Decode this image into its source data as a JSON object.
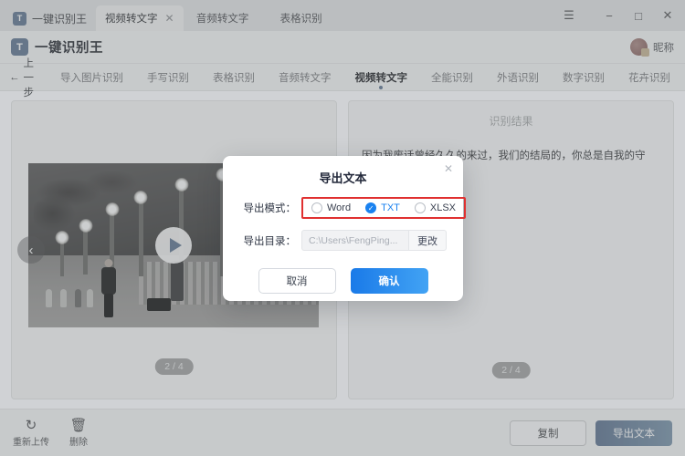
{
  "window": {
    "brand_tab_label": "一键识别王",
    "brand_mark": "T",
    "tabs": [
      {
        "label": "视频转文字",
        "active": true,
        "closable": true
      },
      {
        "label": "音频转文字",
        "active": false,
        "closable": false
      },
      {
        "label": "表格识别",
        "active": false,
        "closable": false
      }
    ],
    "controls": {
      "menu": "☰",
      "minimize": "−",
      "maximize": "□",
      "close": "✕"
    }
  },
  "header": {
    "app_name": "一键识别王",
    "app_mark": "T",
    "user_nickname": "昵称"
  },
  "nav": {
    "back_label": "上一步",
    "back_icon": "←",
    "items": [
      {
        "label": "导入图片识别",
        "active": false
      },
      {
        "label": "手写识别",
        "active": false
      },
      {
        "label": "表格识别",
        "active": false
      },
      {
        "label": "音频转文字",
        "active": false
      },
      {
        "label": "视频转文字",
        "active": true
      },
      {
        "label": "全能识别",
        "active": false
      },
      {
        "label": "外语识别",
        "active": false
      },
      {
        "label": "数字识别",
        "active": false
      },
      {
        "label": "花卉识别",
        "active": false
      }
    ],
    "more_icon": "⌄"
  },
  "left_panel": {
    "pager": "2 / 4",
    "prev_arrow": "‹",
    "play_label": "play"
  },
  "right_panel": {
    "title": "识别结果",
    "recognized_text": "因为我废话曾经久久的来过，我们的结局的，你总是自我的守年。",
    "pager": "2 / 4"
  },
  "footer": {
    "reupload_label": "重新上传",
    "reupload_icon": "↻",
    "delete_label": "删除",
    "delete_icon": "🗑",
    "copy_label": "复制",
    "export_label": "导出文本"
  },
  "modal": {
    "title": "导出文本",
    "close_icon": "✕",
    "mode_label": "导出模式：",
    "options": [
      {
        "label": "Word",
        "selected": false
      },
      {
        "label": "TXT",
        "selected": true
      },
      {
        "label": "XLSX",
        "selected": false
      }
    ],
    "check_glyph": "✓",
    "dir_label": "导出目录：",
    "dir_value": "C:\\Users\\FengPing...",
    "dir_button": "更改",
    "cancel_label": "取消",
    "confirm_label": "确认",
    "highlight_color": "#e03030"
  },
  "colors": {
    "accent": "#1a82f0",
    "brand": "#2f7fe0",
    "highlight": "#e03030"
  }
}
